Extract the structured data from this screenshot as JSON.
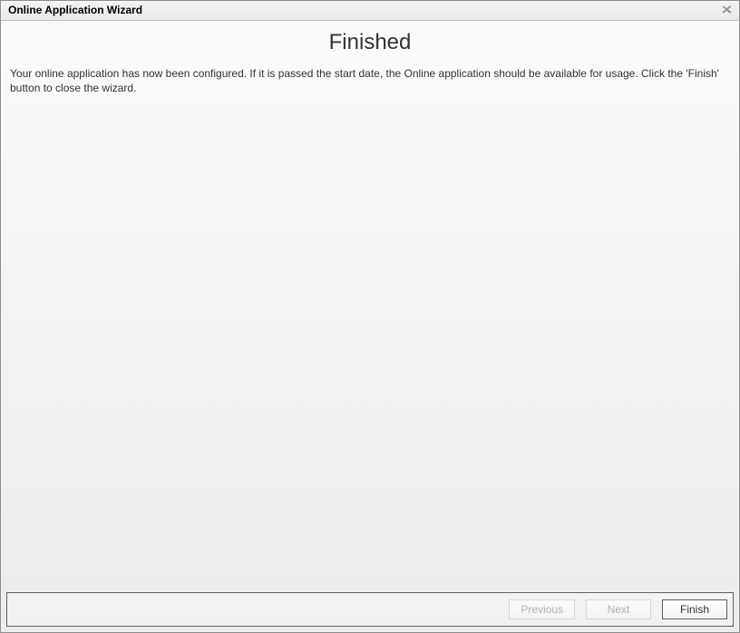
{
  "window": {
    "title": "Online Application Wizard"
  },
  "page": {
    "heading": "Finished",
    "description": "Your online application has now been configured. If it is passed the start date, the Online application should be available for usage. Click the 'Finish' button to close the wizard."
  },
  "footer": {
    "previous_label": "Previous",
    "next_label": "Next",
    "finish_label": "Finish"
  }
}
